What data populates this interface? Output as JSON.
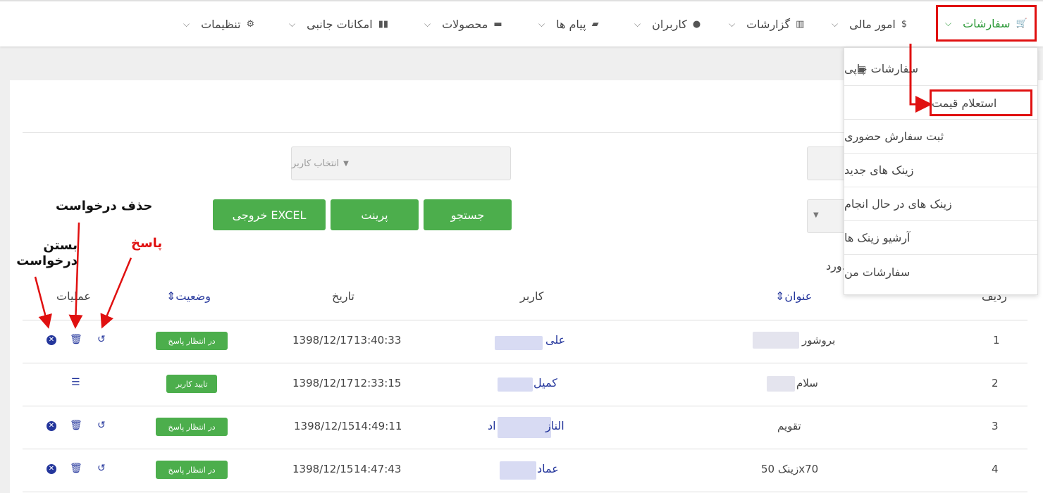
{
  "nav": {
    "orders": "سفارشات",
    "finance": "امور مالی",
    "reports": "گزارشات",
    "users": "کاربران",
    "messages": "پیام ها",
    "products": "محصولات",
    "extras": "امکانات جانبی",
    "settings": "تنظیمات"
  },
  "dropdown": {
    "items": [
      "سفارشات چاپی",
      "استعلام قیمت",
      "ثبت سفارش حضوری",
      "زینک های جدید",
      "زینک های در حال انجام",
      "آرشیو زینک ها",
      "سفارشات من"
    ]
  },
  "filters": {
    "user_select_placeholder": "انتخاب کاربر",
    "partial_note": "ورد."
  },
  "buttons": {
    "search": "جستجو",
    "print": "پرینت",
    "excel": "خروجی EXCEL"
  },
  "table": {
    "headers": {
      "row": "ردیف",
      "title": "عنوان",
      "user": "کاربر",
      "date": "تاریخ",
      "status": "وضعیت",
      "actions": "عملیات"
    },
    "rows": [
      {
        "num": "1",
        "title": "بروشور",
        "user": "علی",
        "date": "1398/12/17",
        "time": "13:40:33",
        "status": "در انتظار پاسخ"
      },
      {
        "num": "2",
        "title": "سلام",
        "user": "کمیل",
        "date": "1398/12/17",
        "time": "12:33:15",
        "status": "تایید کاربر"
      },
      {
        "num": "3",
        "title": "تقویم",
        "user": "الناز",
        "user_tail": "اد",
        "date": "1398/12/15",
        "time": "14:49:11",
        "status": "در انتظار پاسخ"
      },
      {
        "num": "4",
        "title": "زینک 50x70",
        "user": "عماد",
        "date": "1398/12/15",
        "time": "14:47:43",
        "status": "در انتظار پاسخ"
      }
    ]
  },
  "annotations": {
    "close": "بستن درخواست",
    "delete": "حذف درخواست",
    "reply": "پاسخ"
  },
  "colors": {
    "accent_green": "#4cae4c",
    "link_blue": "#24369c",
    "annotation_red": "#e01010"
  }
}
